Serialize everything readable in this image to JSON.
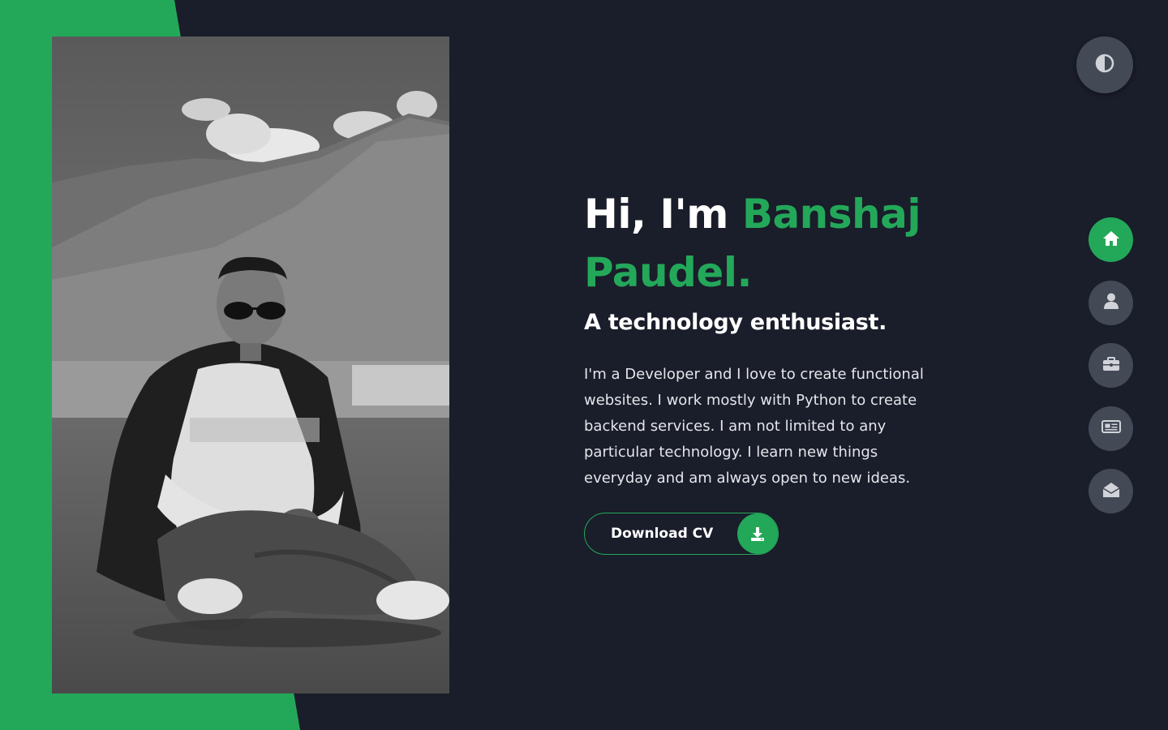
{
  "hero": {
    "greeting": "Hi, I'm",
    "name_line1": "Banshaj",
    "name_line2": "Paudel.",
    "tagline": "A technology enthusiast.",
    "bio": "I'm a Developer and I love to create functional websites. I work mostly with Python to create backend services. I am not limited to any particular technology. I learn new things everyday and am always open to new ideas.",
    "cv_button_label": "Download CV",
    "cv_button_icon": "download-icon"
  },
  "theme_toggle": {
    "icon": "contrast-icon"
  },
  "nav": {
    "items": [
      {
        "icon": "home-icon",
        "active": true
      },
      {
        "icon": "user-icon",
        "active": false
      },
      {
        "icon": "briefcase-icon",
        "active": false
      },
      {
        "icon": "newspaper-icon",
        "active": false
      },
      {
        "icon": "envelope-open-icon",
        "active": false
      }
    ]
  },
  "colors": {
    "background": "#1a1d2a",
    "accent": "#23a859",
    "button_grey": "#434a56",
    "text": "#ffffff"
  }
}
